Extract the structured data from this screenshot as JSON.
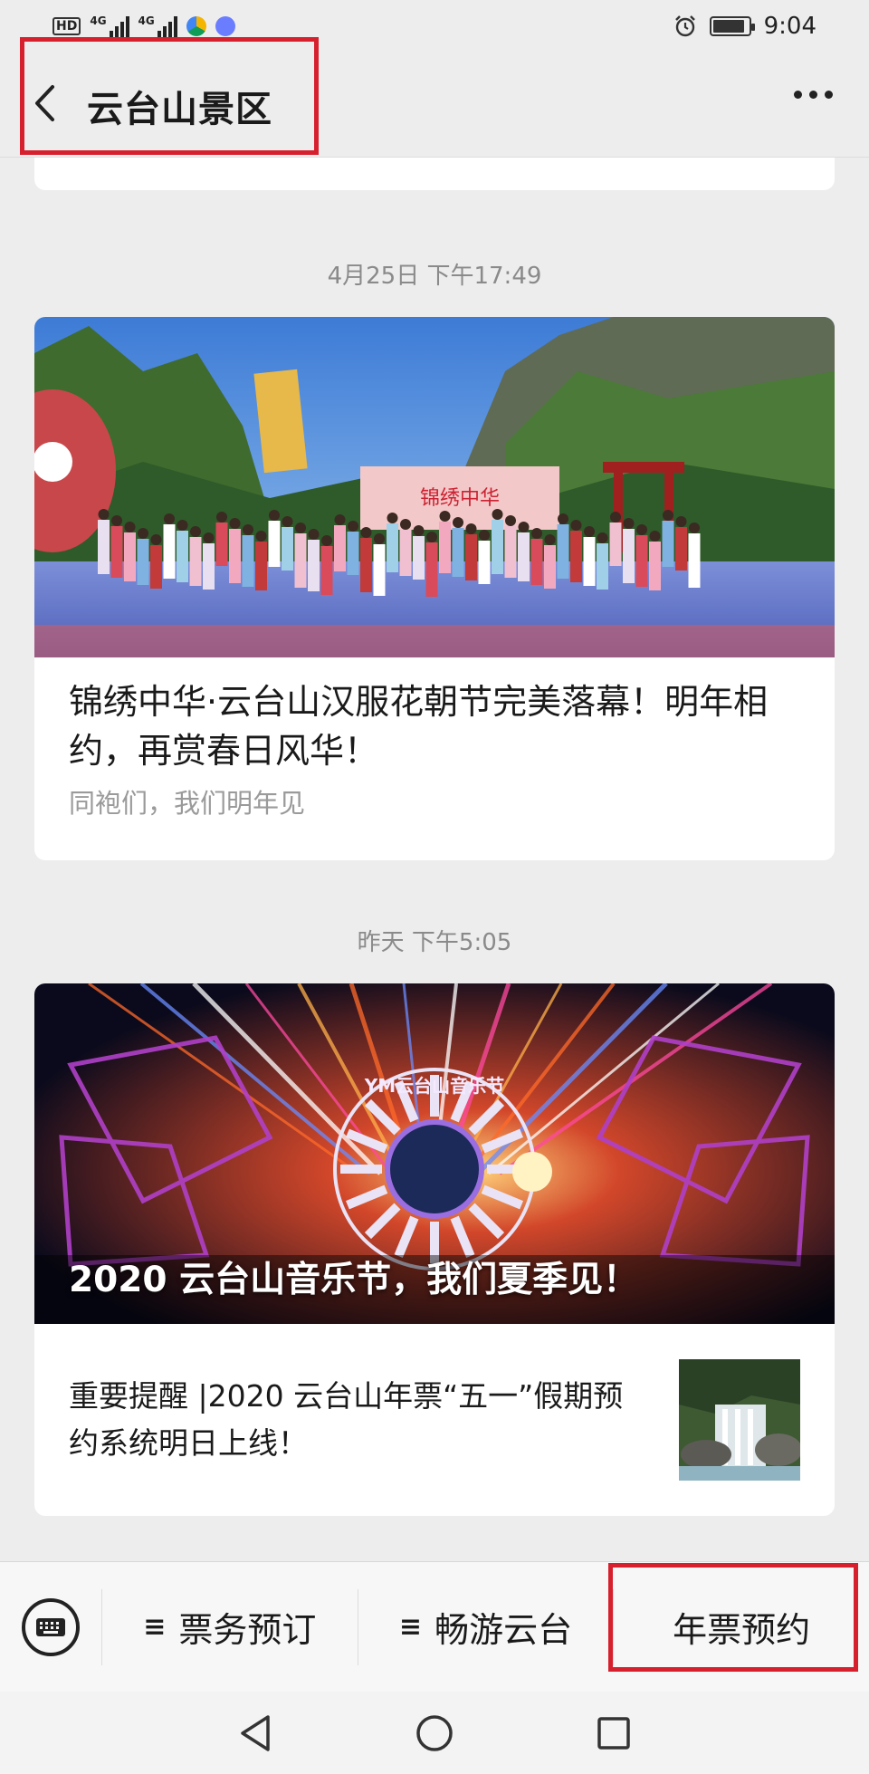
{
  "status_bar": {
    "hd_label": "HD",
    "network_1": "4G",
    "network_2": "4G",
    "time": "9:04",
    "battery_level": 0.9
  },
  "header": {
    "title": "云台山景区"
  },
  "feed": {
    "posts": [
      {
        "timestamp": "4月25日 下午17:49",
        "title": "锦绣中华·云台山汉服花朝节完美落幕！明年相约，再赏春日风华！",
        "summary": "同袍们，我们明年见",
        "banner_text": "锦绣中华"
      },
      {
        "timestamp": "昨天 下午5:05",
        "hero_caption": "2020 云台山音乐节，我们夏季见！",
        "hero_logo": "YM云台山音乐节",
        "sub_article_title": "重要提醒 |2020 云台山年票“五一”假期预约系统明日上线！"
      }
    ]
  },
  "menu": {
    "items": [
      {
        "label": "票务预订",
        "has_submenu": true
      },
      {
        "label": "畅游云台",
        "has_submenu": true
      },
      {
        "label": "年票预约",
        "has_submenu": false
      }
    ],
    "submenu_glyph": "≡"
  },
  "colors": {
    "highlight_border": "#d6202e",
    "background": "#ededed"
  }
}
